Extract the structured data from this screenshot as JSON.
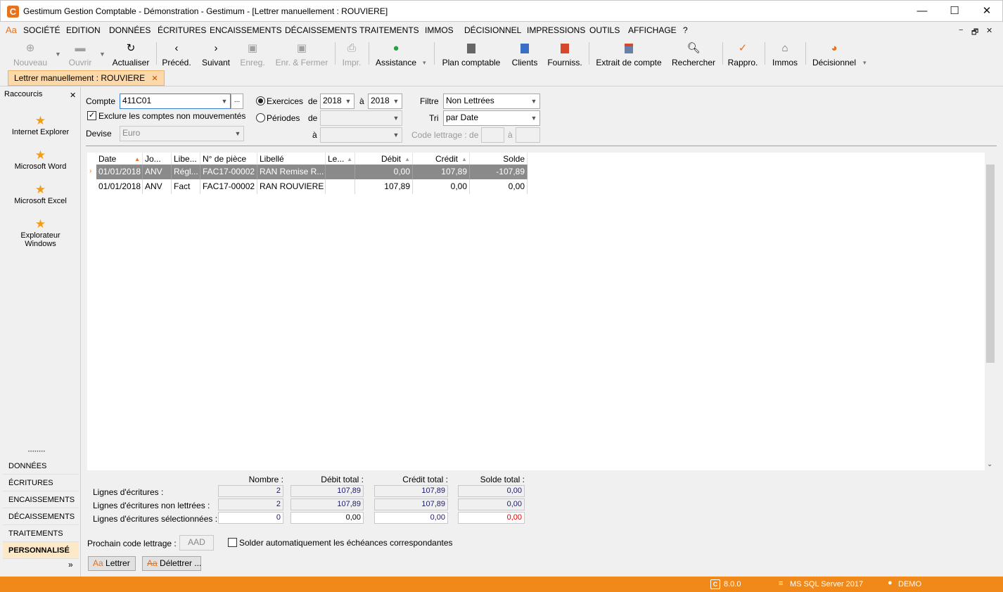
{
  "window": {
    "title": "Gestimum Gestion Comptable - Démonstration - Gestimum - [Lettrer manuellement : ROUVIERE]",
    "app_icon": "C",
    "minimize": "—",
    "maximize": "☐",
    "close": "✕"
  },
  "menu": {
    "aa_icon": "Aa",
    "items": [
      "SOCIÉTÉ",
      "EDITION",
      "DONNÉES",
      "ÉCRITURES",
      "ENCAISSEMENTS",
      "DÉCAISSEMENTS",
      "TRAITEMENTS",
      "IMMOS",
      "DÉCISIONNEL",
      "IMPRESSIONS",
      "OUTILS",
      "AFFICHAGE",
      "?"
    ],
    "mdi": [
      "−",
      "🗗",
      "✕"
    ]
  },
  "toolbar": {
    "nouveau": "Nouveau",
    "ouvrir": "Ouvrir",
    "actualiser": "Actualiser",
    "preced": "Précéd.",
    "suivant": "Suivant",
    "enreg": "Enreg.",
    "enr_fermer": "Enr. & Fermer",
    "impr": "Impr.",
    "assistance": "Assistance",
    "plan_comptable": "Plan comptable",
    "clients": "Clients",
    "fourniss": "Fourniss.",
    "extrait": "Extrait de compte",
    "rechercher": "Rechercher",
    "rappro": "Rappro.",
    "immos": "Immos",
    "decisionnel": "Décisionnel"
  },
  "tab": {
    "label": "Lettrer manuellement : ROUVIERE",
    "close": "✕"
  },
  "sidebar": {
    "title": "Raccourcis",
    "close": "✕",
    "shortcuts": [
      "Internet Explorer",
      "Microsoft Word",
      "Microsoft Excel",
      "Explorateur Windows"
    ],
    "grip": "••••••••",
    "nav": [
      "DONNÉES",
      "ÉCRITURES",
      "ENCAISSEMENTS",
      "DÉCAISSEMENTS",
      "TRAITEMENTS",
      "PERSONNALISÉ"
    ],
    "more": "»"
  },
  "form": {
    "compte_label": "Compte",
    "compte_value": "411C01",
    "compte_btn": "...",
    "exclure_label": "Exclure les comptes non mouvementés",
    "devise_label": "Devise",
    "devise_value": "Euro",
    "exercices_label": "Exercices",
    "periodes_label": "Périodes",
    "de_label": "de",
    "a_label": "à",
    "exercice_de": "2018",
    "exercice_a": "2018",
    "filtre_label": "Filtre",
    "filtre_value": "Non Lettrées",
    "tri_label": "Tri",
    "tri_value": "par Date",
    "code_lettrage_label": "Code lettrage : de",
    "code_lettrage_a": "à"
  },
  "grid": {
    "headers": [
      "Date",
      "Jo...",
      "Libe...",
      "N° de pièce",
      "Libellé",
      "Le...",
      "Débit",
      "Crédit",
      "Solde"
    ],
    "rows": [
      [
        "01/01/2018",
        "ANV",
        "Régl...",
        "FAC17-00002",
        "RAN Remise R...",
        "",
        "0,00",
        "107,89",
        "-107,89"
      ],
      [
        "01/01/2018",
        "ANV",
        "Fact",
        "FAC17-00002",
        "RAN ROUVIERE",
        "",
        "107,89",
        "0,00",
        "0,00"
      ]
    ]
  },
  "summary": {
    "headers": [
      "Nombre :",
      "Débit total :",
      "Crédit total :",
      "Solde total :"
    ],
    "rows": [
      {
        "label": "Lignes d'écritures :",
        "values": [
          "2",
          "107,89",
          "107,89",
          "0,00"
        ]
      },
      {
        "label": "Lignes d'écritures non lettrées :",
        "values": [
          "2",
          "107,89",
          "107,89",
          "0,00"
        ]
      },
      {
        "label": "Lignes d'écritures sélectionnées :",
        "values": [
          "0",
          "0,00",
          "0,00",
          "0,00"
        ]
      }
    ]
  },
  "bottom": {
    "prochain_label": "Prochain code lettrage :",
    "prochain_value": "AAD",
    "solder_label": "Solder automatiquement les échéances correspondantes",
    "lettrer": "Lettrer",
    "delettrer": "Délettrer ...",
    "aa": "Aa"
  },
  "status": {
    "version": "8.0.0",
    "server": "MS SQL Server 2017",
    "user": "DEMO"
  },
  "colors": {
    "accent": "#f0881a",
    "selected_row": "#8a8a8a",
    "negative": "#e00000"
  }
}
